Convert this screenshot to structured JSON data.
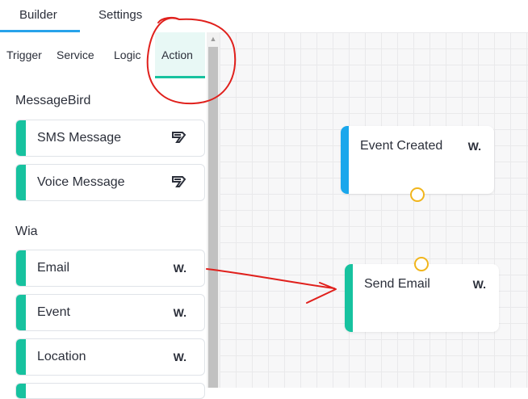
{
  "top_tabs": {
    "builder": "Builder",
    "settings": "Settings"
  },
  "sub_tabs": {
    "trigger": "Trigger",
    "service": "Service",
    "logic": "Logic",
    "action": "Action"
  },
  "sections": {
    "messagebird": {
      "title": "MessageBird",
      "items": [
        {
          "label": "SMS Message",
          "icon": "messagebird-icon"
        },
        {
          "label": "Voice Message",
          "icon": "messagebird-icon"
        }
      ]
    },
    "wia": {
      "title": "Wia",
      "items": [
        {
          "label": "Email",
          "icon": "wia-icon"
        },
        {
          "label": "Event",
          "icon": "wia-icon"
        },
        {
          "label": "Location",
          "icon": "wia-icon"
        }
      ]
    }
  },
  "canvas": {
    "nodes": [
      {
        "label": "Event Created",
        "icon": "wia-icon",
        "stripe_color": "#1aa7ec"
      },
      {
        "label": "Send Email",
        "icon": "wia-icon",
        "stripe_color": "#17c29f"
      }
    ]
  },
  "wia_glyph": "W.",
  "colors": {
    "accent_blue": "#27a3ea",
    "accent_teal": "#17c29f",
    "port_yellow": "#f1b51c",
    "annotation_red": "#e0201c"
  }
}
